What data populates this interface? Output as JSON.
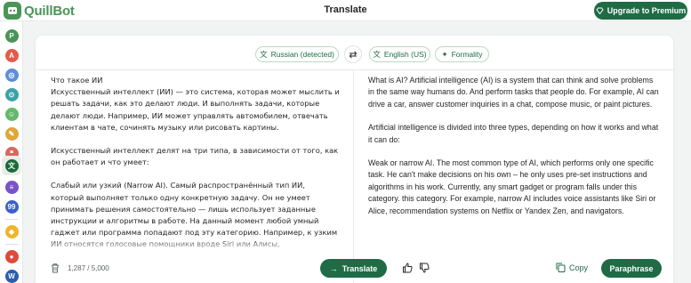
{
  "app": {
    "name": "QuillBot",
    "page_title": "Translate",
    "upgrade_label": "Upgrade to Premium"
  },
  "colors": {
    "brand": "#499557",
    "primary_button": "#1e6b45"
  },
  "rail": [
    {
      "icon": "paraphraser-icon",
      "color": "#499557"
    },
    {
      "icon": "grammar-checker-icon",
      "color": "#e35b4b"
    },
    {
      "icon": "ai-detector-icon",
      "color": "#5c8fd9"
    },
    {
      "icon": "plagiarism-checker-icon",
      "color": "#3ba3a7"
    },
    {
      "icon": "ai-humanizer-icon",
      "color": "#64b96a"
    },
    {
      "icon": "ai-chat-icon",
      "color": "#e0a63a"
    },
    {
      "icon": "citation-generator-icon",
      "color": "#d9685b"
    },
    {
      "icon": "translator-icon",
      "color": "#1b6b3a"
    },
    {
      "icon": "summarizer-icon",
      "color": "#7a52c9"
    },
    {
      "icon": "quillbot-flow-icon",
      "color": "#3a62c2"
    },
    {
      "icon": "premium-icon",
      "color": "#f0b429"
    },
    {
      "icon": "chrome-extension-icon",
      "color": "#de4a3c"
    },
    {
      "icon": "word-extension-icon",
      "color": "#2b5fae"
    }
  ],
  "toolbar": {
    "source_lang": "Russian (detected)",
    "target_lang": "English (US)",
    "formality": "Formality"
  },
  "input": {
    "paragraphs": [
      "Что такое ИИ\nИскусственный интеллект (ИИ) — это система, которая может мыслить и решать задачи, как это делают люди. И выполнять задачи, которые делают люди. Например, ИИ может управлять автомобилем, отвечать клиентам в чате, сочинять музыку или рисовать картины.",
      "Искусственный интеллект делят на три типа, в зависимости от того, как он работает и что умеет:",
      "Слабый или узкий (Narrow AI). Самый распространённый тип ИИ, который выполняет только одну конкретную задачу. Он не умеет принимать решения самостоятельно — лишь использует заданные инструкции и алгоритмы в работе. На данный момент любой умный гаджет или программа попадают под эту категорию. Например, к узким ИИ относятся голосовые помощники вроде Siri или Алисы, рекомендательные системы на Netflix или в Дзене, навигаторы."
    ],
    "counter": "1,287 / 5,000"
  },
  "output": {
    "paragraphs": [
      "What is AI? Artificial intelligence (AI) is a system that can think and solve problems in the same way humans do. And perform tasks that people do. For example, AI can drive a car, answer customer inquiries in a chat, compose music, or paint pictures.",
      "Artificial intelligence is divided into three types, depending on how it works and what it can do:",
      "Weak or narrow AI. The most common type of AI, which performs only one specific task. He can't make decisions on his own – he only uses pre-set instructions and algorithms in his work. Currently, any smart gadget or program falls under this category. this category. For example, narrow AI includes voice assistants like Siri or Alice, recommendation systems on Netflix or Yandex Zen, and navigators."
    ]
  },
  "actions": {
    "translate_label": "Translate",
    "copy_label": "Copy",
    "paraphrase_label": "Paraphrase"
  }
}
